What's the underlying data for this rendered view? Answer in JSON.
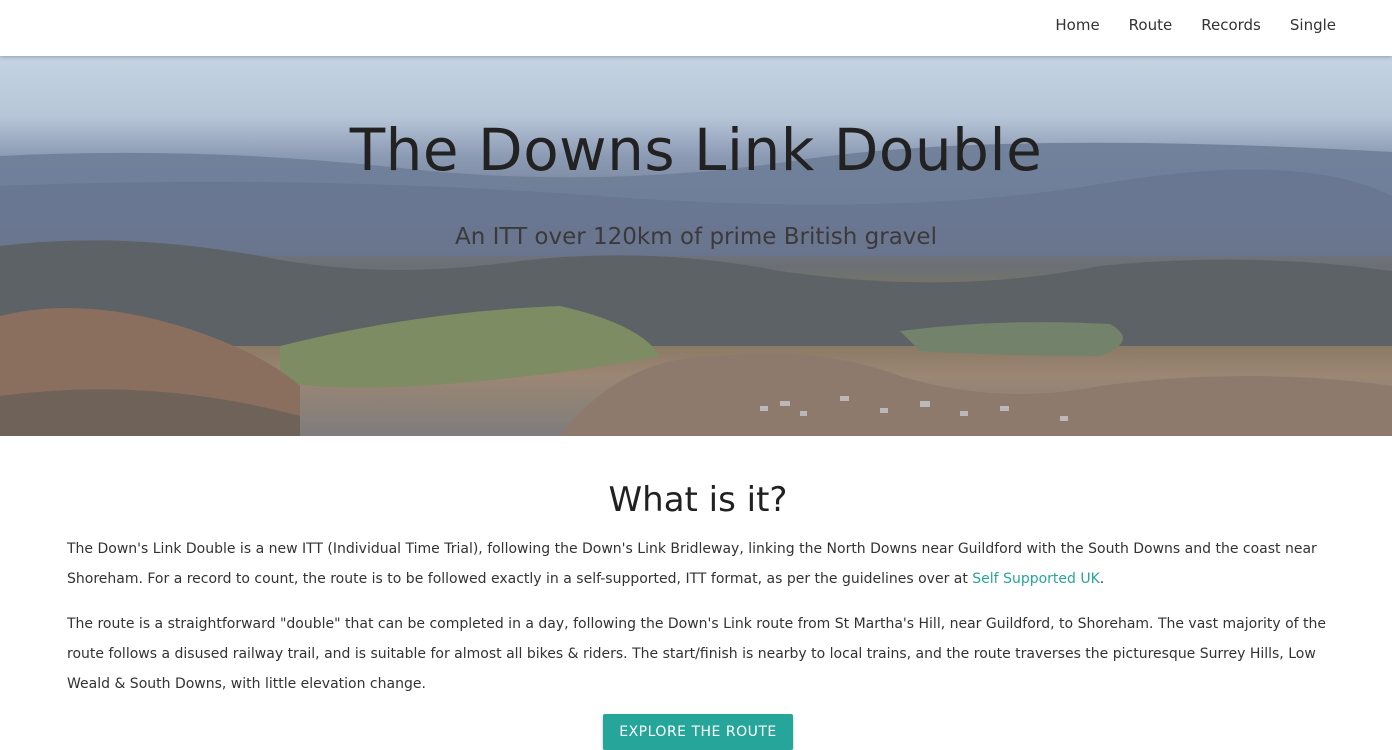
{
  "nav": {
    "items": [
      {
        "label": "Home"
      },
      {
        "label": "Route"
      },
      {
        "label": "Records"
      },
      {
        "label": "Single"
      }
    ]
  },
  "hero": {
    "title": "The Downs Link Double",
    "subtitle": "An ITT over 120km of prime British gravel"
  },
  "about": {
    "heading": "What is it?",
    "para1_text": "The Down's Link Double is a new ITT (Individual Time Trial), following the Down's Link Bridleway, linking the North Downs near Guildford with the South Downs and the coast near Shoreham. For a record to count, the route is to be followed exactly in a self-supported, ITT format, as per the guidelines over at ",
    "para1_link": "Self Supported UK",
    "para1_end": ".",
    "para2_text": "The route is a straightforward \"double\" that can be completed in a day, following the Down's Link route from St Martha's Hill, near Guildford, to Shoreham. The vast majority of the route follows a disused railway trail, and is suitable for almost all bikes & riders. The start/finish is nearby to local trains, and the route traverses the picturesque Surrey Hills, Low Weald & South Downs, with little elevation change.",
    "button_label": "EXPLORE THE ROUTE"
  },
  "colors": {
    "accent": "#26a69a",
    "text": "#212121"
  }
}
